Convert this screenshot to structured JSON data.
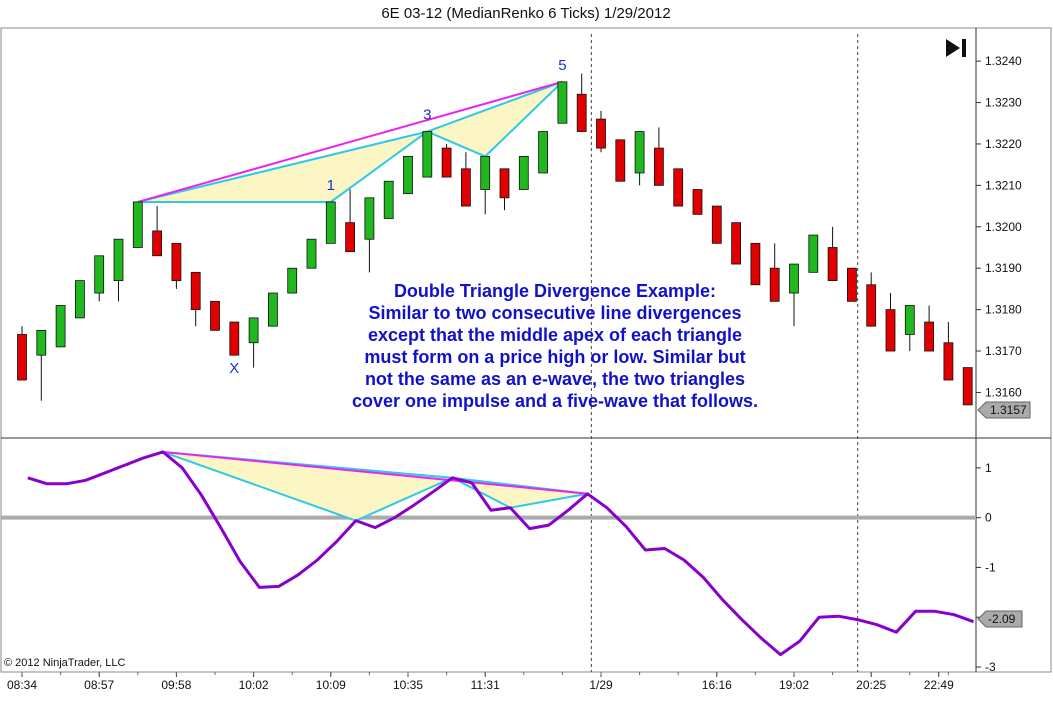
{
  "window_title": "6E 03-12 (MedianRenko 6 Ticks)  1/29/2012",
  "copyright": "© 2012 NinjaTrader, LLC",
  "play_icon": "skip-to-end-icon",
  "colors": {
    "up_candle": "#1fb81f",
    "down_candle": "#e00000",
    "oscillator": "#8800cc",
    "triangle_edge": "#2ec8e8",
    "triangle_fill": "#fbf6c4",
    "divergence_line": "#ee22ee",
    "zero_line": "#aaaaaa",
    "label_blue": "#1a2fd0",
    "annotation": "#1111cc"
  },
  "annotation": {
    "lines": [
      "Double Triangle Divergence Example:",
      "Similar to two consecutive line divergences",
      "except that the middle apex of each triangle",
      "must form on a price high or low. Similar but",
      "not the same as an e-wave, the two triangles",
      "cover one impulse and a five-wave that follows."
    ]
  },
  "chart_data": [
    {
      "type": "candlestick",
      "title": "6E 03-12 (MedianRenko 6 Ticks)  1/29/2012",
      "x_labels": [
        "08:34",
        "08:57",
        "09:58",
        "10:02",
        "10:09",
        "10:35",
        "11:31",
        "1/29",
        "16:16",
        "19:02",
        "20:25",
        "22:49"
      ],
      "y_ticks": [
        "1.3160",
        "1.3170",
        "1.3180",
        "1.3190",
        "1.3200",
        "1.3210",
        "1.3220",
        "1.3230",
        "1.3240"
      ],
      "ylim": [
        1.3149,
        1.3248
      ],
      "last_price": "1.3157",
      "session_breaks": [
        "1/29",
        "20:25"
      ],
      "wave_labels": [
        {
          "text": "X",
          "bar": 11
        },
        {
          "text": "1",
          "bar": 16
        },
        {
          "text": "3",
          "bar": 21
        },
        {
          "text": "5",
          "bar": 28
        }
      ],
      "candles": [
        {
          "o": 1.3174,
          "c": 1.3163,
          "h": 1.3176,
          "l": 1.3163
        },
        {
          "o": 1.3169,
          "c": 1.3175,
          "h": 1.3175,
          "l": 1.3158
        },
        {
          "o": 1.3171,
          "c": 1.3181,
          "h": 1.3181,
          "l": 1.3171
        },
        {
          "o": 1.3178,
          "c": 1.3187,
          "h": 1.3187,
          "l": 1.3178
        },
        {
          "o": 1.3184,
          "c": 1.3193,
          "h": 1.3193,
          "l": 1.3182
        },
        {
          "o": 1.3187,
          "c": 1.3197,
          "h": 1.3197,
          "l": 1.3182
        },
        {
          "o": 1.3195,
          "c": 1.3206,
          "h": 1.3206,
          "l": 1.3195
        },
        {
          "o": 1.3199,
          "c": 1.3193,
          "h": 1.3205,
          "l": 1.3193
        },
        {
          "o": 1.3196,
          "c": 1.3187,
          "h": 1.3196,
          "l": 1.3185
        },
        {
          "o": 1.3189,
          "c": 1.318,
          "h": 1.3189,
          "l": 1.3176
        },
        {
          "o": 1.3182,
          "c": 1.3175,
          "h": 1.3182,
          "l": 1.3175
        },
        {
          "o": 1.3177,
          "c": 1.3169,
          "h": 1.3177,
          "l": 1.3169
        },
        {
          "o": 1.3172,
          "c": 1.3178,
          "h": 1.3178,
          "l": 1.3166
        },
        {
          "o": 1.3176,
          "c": 1.3184,
          "h": 1.3184,
          "l": 1.3176
        },
        {
          "o": 1.3184,
          "c": 1.319,
          "h": 1.319,
          "l": 1.3184
        },
        {
          "o": 1.319,
          "c": 1.3197,
          "h": 1.3197,
          "l": 1.319
        },
        {
          "o": 1.3196,
          "c": 1.3206,
          "h": 1.3206,
          "l": 1.3196
        },
        {
          "o": 1.3201,
          "c": 1.3194,
          "h": 1.3209,
          "l": 1.3194
        },
        {
          "o": 1.3197,
          "c": 1.3207,
          "h": 1.3207,
          "l": 1.3189
        },
        {
          "o": 1.3202,
          "c": 1.3211,
          "h": 1.3211,
          "l": 1.3202
        },
        {
          "o": 1.3208,
          "c": 1.3217,
          "h": 1.3217,
          "l": 1.3208
        },
        {
          "o": 1.3212,
          "c": 1.3223,
          "h": 1.3223,
          "l": 1.3212
        },
        {
          "o": 1.3219,
          "c": 1.3212,
          "h": 1.322,
          "l": 1.3212
        },
        {
          "o": 1.3214,
          "c": 1.3205,
          "h": 1.3218,
          "l": 1.3205
        },
        {
          "o": 1.3209,
          "c": 1.3217,
          "h": 1.3217,
          "l": 1.3203
        },
        {
          "o": 1.3214,
          "c": 1.3207,
          "h": 1.3214,
          "l": 1.3204
        },
        {
          "o": 1.3209,
          "c": 1.3217,
          "h": 1.3217,
          "l": 1.3209
        },
        {
          "o": 1.3213,
          "c": 1.3223,
          "h": 1.3223,
          "l": 1.3213
        },
        {
          "o": 1.3225,
          "c": 1.3235,
          "h": 1.3235,
          "l": 1.3225
        },
        {
          "o": 1.3232,
          "c": 1.3223,
          "h": 1.3237,
          "l": 1.3223
        },
        {
          "o": 1.3226,
          "c": 1.3219,
          "h": 1.3228,
          "l": 1.3218
        },
        {
          "o": 1.3221,
          "c": 1.3211,
          "h": 1.3221,
          "l": 1.3211
        },
        {
          "o": 1.3213,
          "c": 1.3223,
          "h": 1.3223,
          "l": 1.321
        },
        {
          "o": 1.3219,
          "c": 1.321,
          "h": 1.3224,
          "l": 1.321
        },
        {
          "o": 1.3214,
          "c": 1.3205,
          "h": 1.3214,
          "l": 1.3205
        },
        {
          "o": 1.3209,
          "c": 1.3203,
          "h": 1.3209,
          "l": 1.3203
        },
        {
          "o": 1.3205,
          "c": 1.3196,
          "h": 1.3205,
          "l": 1.3196
        },
        {
          "o": 1.3201,
          "c": 1.3191,
          "h": 1.3201,
          "l": 1.3191
        },
        {
          "o": 1.3196,
          "c": 1.3186,
          "h": 1.3196,
          "l": 1.3186
        },
        {
          "o": 1.319,
          "c": 1.3182,
          "h": 1.3196,
          "l": 1.3182
        },
        {
          "o": 1.3184,
          "c": 1.3191,
          "h": 1.3191,
          "l": 1.3176
        },
        {
          "o": 1.3189,
          "c": 1.3198,
          "h": 1.3198,
          "l": 1.3189
        },
        {
          "o": 1.3195,
          "c": 1.3187,
          "h": 1.32,
          "l": 1.3187
        },
        {
          "o": 1.319,
          "c": 1.3182,
          "h": 1.319,
          "l": 1.3182
        },
        {
          "o": 1.3186,
          "c": 1.3176,
          "h": 1.3189,
          "l": 1.3176
        },
        {
          "o": 1.318,
          "c": 1.317,
          "h": 1.3184,
          "l": 1.317
        },
        {
          "o": 1.3174,
          "c": 1.3181,
          "h": 1.3181,
          "l": 1.317
        },
        {
          "o": 1.3177,
          "c": 1.317,
          "h": 1.3181,
          "l": 1.317
        },
        {
          "o": 1.3172,
          "c": 1.3163,
          "h": 1.3177,
          "l": 1.3163
        },
        {
          "o": 1.3166,
          "c": 1.3157,
          "h": 1.3166,
          "l": 1.3157
        }
      ]
    },
    {
      "type": "line",
      "y_ticks": [
        "-3",
        "-2",
        "-1",
        "0",
        "1"
      ],
      "ylim": [
        -3.1,
        1.6
      ],
      "last_value": "-2.09",
      "values": [
        0.8,
        0.68,
        0.68,
        0.75,
        0.9,
        1.05,
        1.2,
        1.32,
        1.0,
        0.45,
        -0.2,
        -0.88,
        -1.4,
        -1.38,
        -1.15,
        -0.85,
        -0.48,
        -0.06,
        -0.2,
        0.0,
        0.25,
        0.52,
        0.8,
        0.7,
        0.15,
        0.2,
        -0.22,
        -0.15,
        0.15,
        0.48,
        0.2,
        -0.18,
        -0.65,
        -0.62,
        -0.85,
        -1.2,
        -1.65,
        -2.05,
        -2.42,
        -2.75,
        -2.48,
        -2.0,
        -1.98,
        -2.05,
        -2.15,
        -2.3,
        -1.88,
        -1.88,
        -1.95,
        -2.09
      ]
    }
  ]
}
